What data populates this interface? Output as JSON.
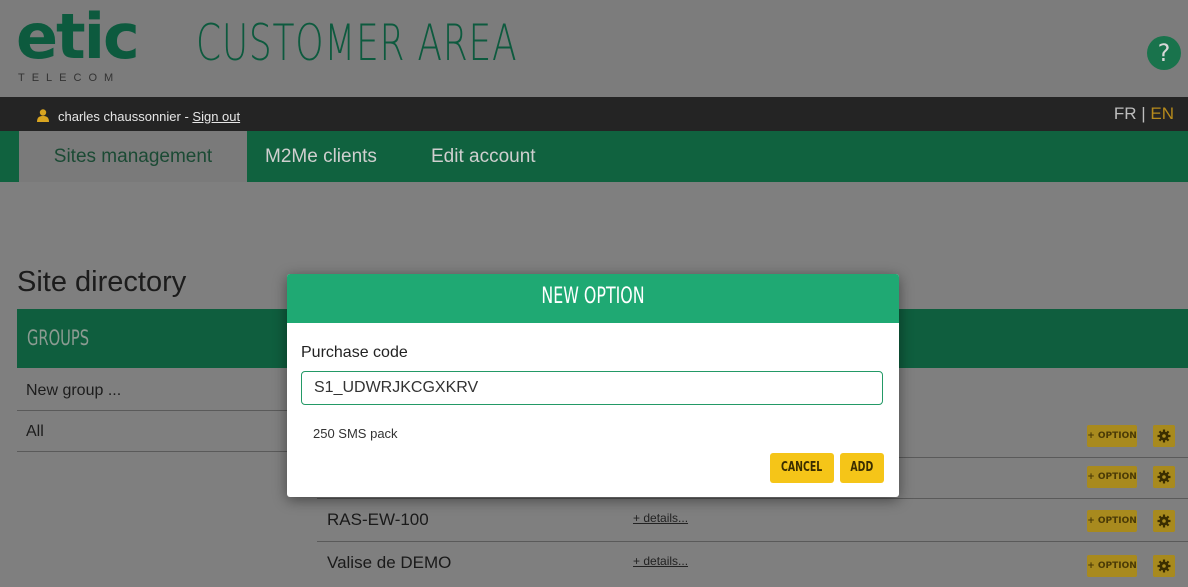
{
  "header": {
    "logo_text": "etic",
    "logo_subtext": "TELECOM",
    "title": "CUSTOMER AREA",
    "help_label": "?"
  },
  "userbar": {
    "user_name": "charles chaussonnier - ",
    "sign_out": "Sign out",
    "lang_fr": "FR",
    "lang_sep": " | ",
    "lang_en": "EN"
  },
  "nav": {
    "tabs": [
      {
        "label": "Sites management",
        "active": true
      },
      {
        "label": "M2Me clients",
        "active": false
      },
      {
        "label": "Edit account",
        "active": false
      }
    ]
  },
  "main": {
    "heading": "Site directory",
    "groups_header": "GROUPS",
    "groups": [
      "New group ...",
      "All"
    ],
    "sites": [
      {
        "name": "",
        "details": ""
      },
      {
        "name": "",
        "details": ""
      },
      {
        "name": "RAS-EW-100",
        "details": "+ details..."
      },
      {
        "name": "Valise de DEMO",
        "details": "+ details..."
      }
    ],
    "option_button": "+ OPTION",
    "settings_icon": "gear-icon"
  },
  "modal": {
    "title": "NEW OPTION",
    "field_label": "Purchase code",
    "field_value": "S1_UDWRJKCGXKRV",
    "option_description": "250 SMS pack",
    "cancel_label": "CANCEL",
    "add_label": "ADD"
  },
  "colors": {
    "brand_green": "#1fa973",
    "dark_green": "#0f5e3e",
    "button_yellow": "#f5c518",
    "lang_active": "#b68a1c"
  }
}
